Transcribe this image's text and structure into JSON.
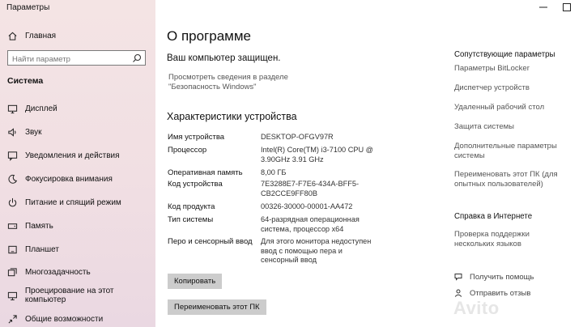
{
  "window": {
    "title": "Параметры"
  },
  "search": {
    "placeholder": "Найти параметр"
  },
  "sidebar": {
    "home_label": "Главная",
    "section_label": "Система",
    "items": [
      {
        "label": "Дисплей",
        "icon": "monitor-icon"
      },
      {
        "label": "Звук",
        "icon": "speaker-icon"
      },
      {
        "label": "Уведомления и действия",
        "icon": "notification-icon"
      },
      {
        "label": "Фокусировка внимания",
        "icon": "moon-icon"
      },
      {
        "label": "Питание и спящий режим",
        "icon": "power-icon"
      },
      {
        "label": "Память",
        "icon": "storage-icon"
      },
      {
        "label": "Планшет",
        "icon": "tablet-icon"
      },
      {
        "label": "Многозадачность",
        "icon": "multitask-icon"
      },
      {
        "label": "Проецирование на этот компьютер",
        "icon": "project-icon"
      },
      {
        "label": "Общие возможности",
        "icon": "share-icon"
      }
    ]
  },
  "main": {
    "title": "О программе",
    "protected_text": "Ваш компьютер защищен.",
    "security_link_line1": "Просмотреть сведения в разделе",
    "security_link_line2": "\"Безопасность Windows\"",
    "specs_heading": "Характеристики устройства",
    "specs": [
      {
        "label": "Имя устройства",
        "value": "DESKTOP-OFGV97R"
      },
      {
        "label": "Процессор",
        "value": "Intel(R) Core(TM) i3-7100 CPU @ 3.90GHz   3.91 GHz"
      },
      {
        "label": "Оперативная память",
        "value": "8,00 ГБ"
      },
      {
        "label": "Код устройства",
        "value": "7E3288E7-F7E6-434A-BFF5-CB2CCE9FF80B"
      },
      {
        "label": "Код продукта",
        "value": "00326-30000-00001-AA472"
      },
      {
        "label": "Тип системы",
        "value": "64-разрядная операционная система, процессор x64"
      },
      {
        "label": "Перо и сенсорный ввод",
        "value": "Для этого монитора недоступен ввод с помощью пера и сенсорный ввод"
      }
    ],
    "copy_button": "Копировать",
    "rename_button": "Переименовать этот ПК"
  },
  "related": {
    "heading": "Сопутствующие параметры",
    "links": [
      "Параметры BitLocker",
      "Диспетчер устройств",
      "Удаленный рабочий стол",
      "Защита системы",
      "Дополнительные параметры системы",
      "Переименовать этот ПК (для опытных пользователей)"
    ]
  },
  "web_help": {
    "heading": "Справка в Интернете",
    "links": [
      "Проверка поддержки нескольких языков"
    ]
  },
  "help_links": [
    {
      "label": "Получить помощь",
      "icon": "help-icon"
    },
    {
      "label": "Отправить отзыв",
      "icon": "feedback-icon"
    }
  ],
  "watermark": "Avito"
}
